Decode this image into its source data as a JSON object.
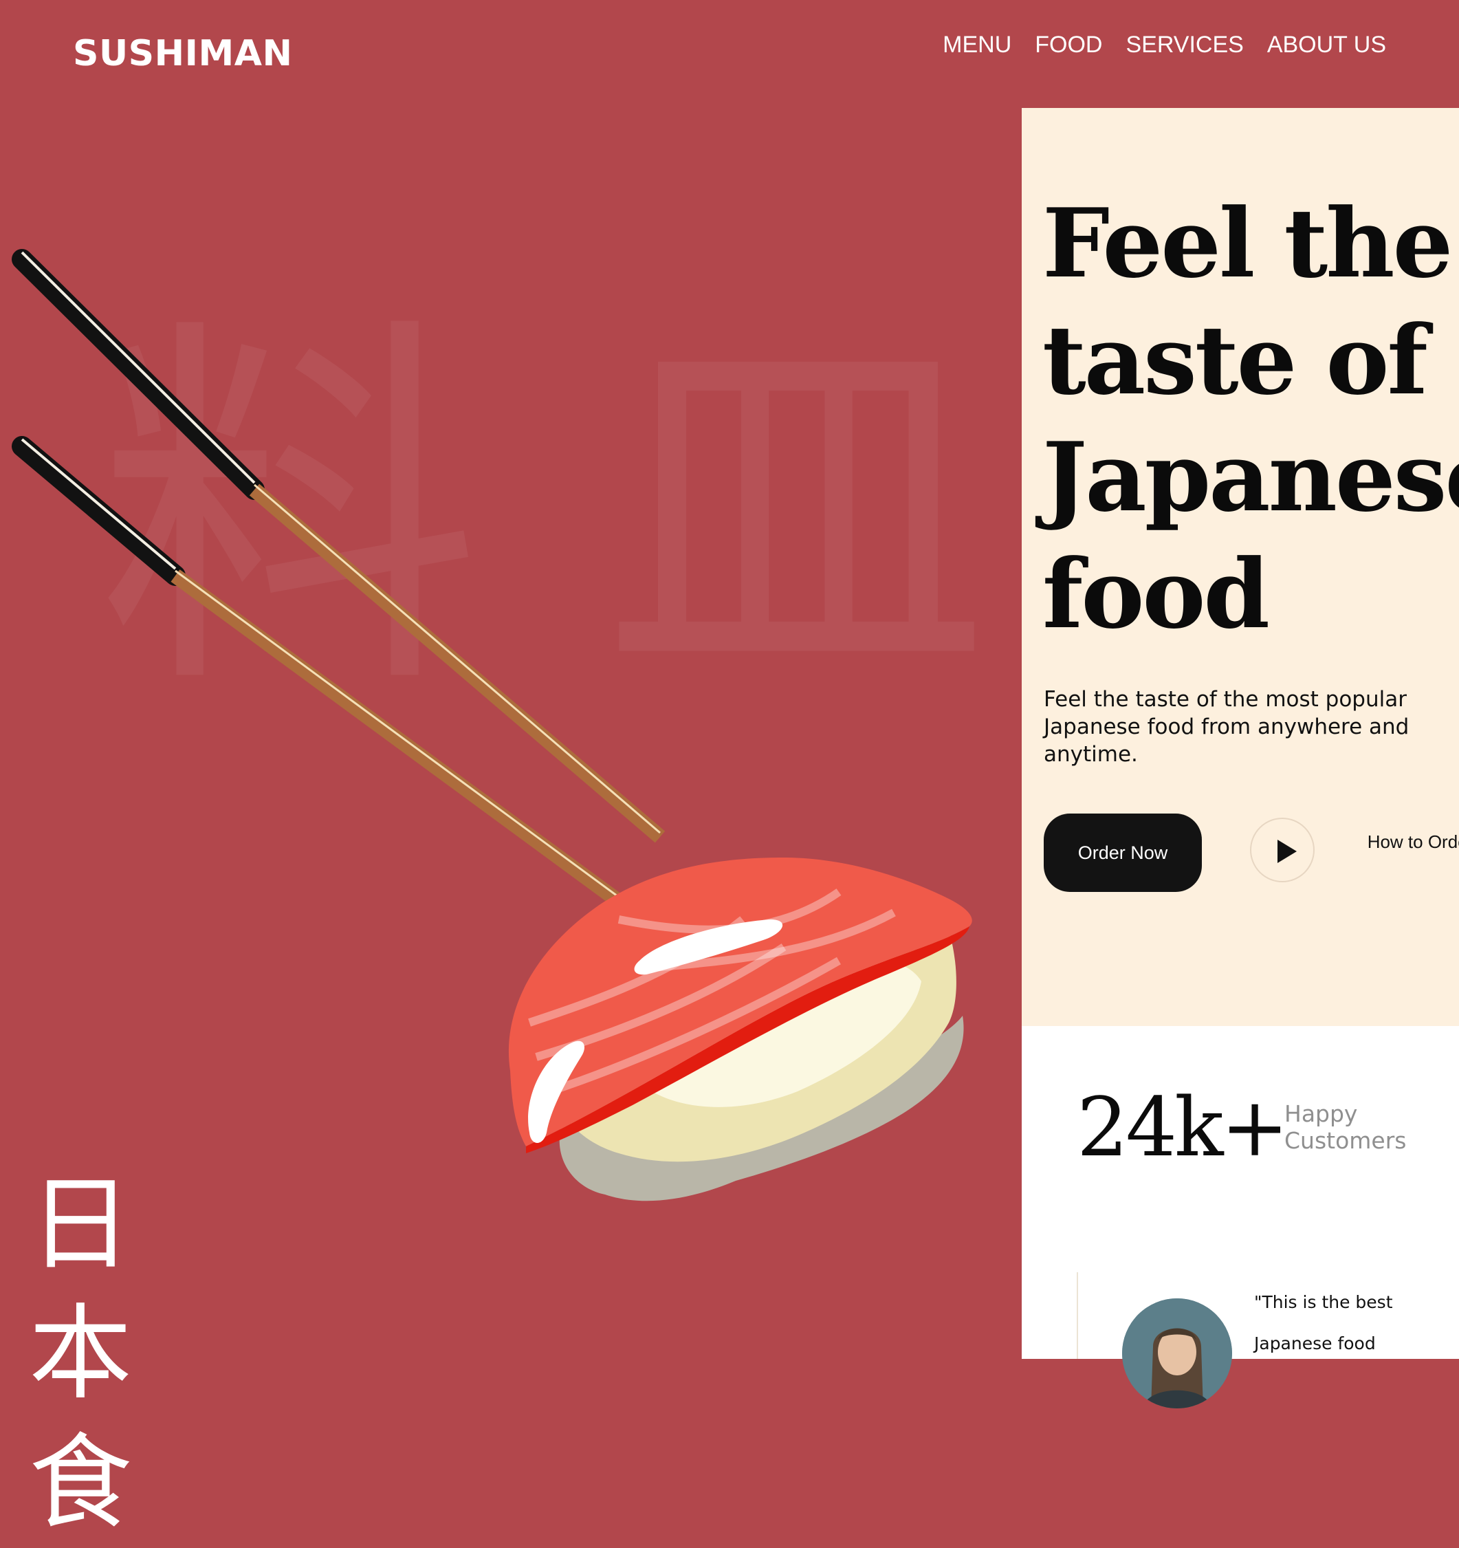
{
  "brand": {
    "name": "SUSHIMAN"
  },
  "nav": {
    "items": [
      {
        "label": "MENU"
      },
      {
        "label": "FOOD"
      },
      {
        "label": "SERVICES"
      },
      {
        "label": "ABOUT US"
      }
    ]
  },
  "hero": {
    "background_glyphs": "料 皿",
    "vertical_text": [
      "日",
      "本",
      "食"
    ],
    "illustration": "sushi-with-chopsticks"
  },
  "panel": {
    "headline": "Feel the taste of Japanese food",
    "subtext": "Feel the taste of the most popular Japanese food from anywhere and anytime.",
    "order_button": "Order Now",
    "play_icon": "play-icon",
    "how_to_order": "How to Order"
  },
  "stats": {
    "value": "24k+",
    "label": "Happy Customers"
  },
  "testimonial": {
    "quote_lines": [
      "\"This is the best",
      "Japanese food"
    ]
  },
  "colors": {
    "background": "#b2474c",
    "panel": "#fdf0de",
    "button": "#131313",
    "text_dark": "#0b0b0b",
    "text_muted": "#8f8f8f"
  }
}
